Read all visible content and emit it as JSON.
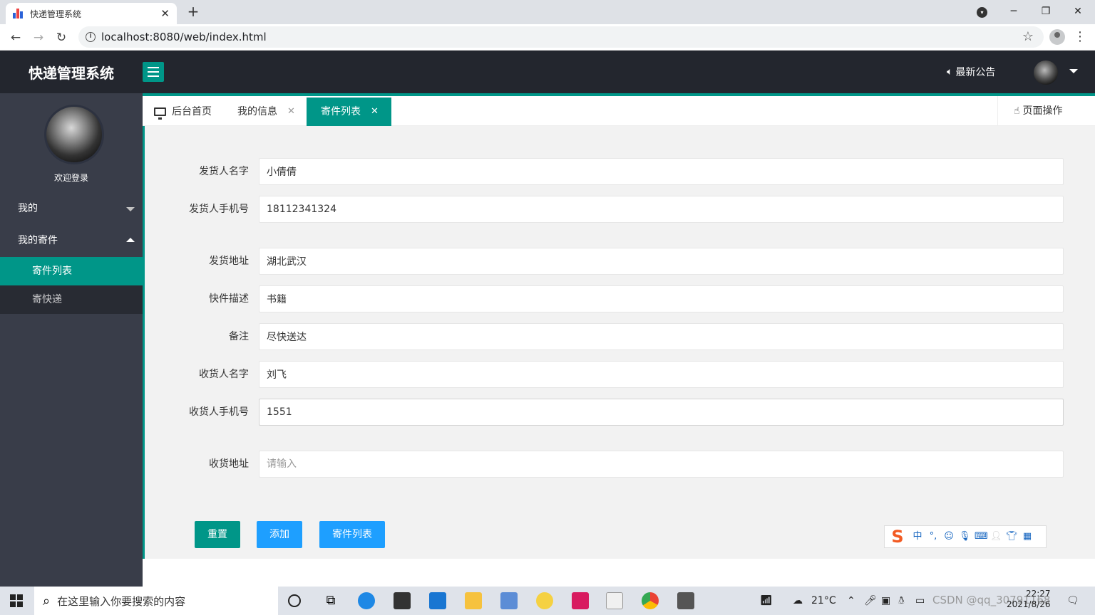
{
  "browser": {
    "tab_title": "快递管理系统",
    "url": "localhost:8080/web/index.html"
  },
  "header": {
    "app_title": "快递管理系统",
    "notice_label": "最新公告"
  },
  "sidebar": {
    "welcome": "欢迎登录",
    "groups": [
      {
        "label": "我的",
        "expanded": false
      },
      {
        "label": "我的寄件",
        "expanded": true
      }
    ],
    "items": [
      {
        "label": "寄件列表",
        "active": true
      },
      {
        "label": "寄快递",
        "active": false
      }
    ]
  },
  "tabs": [
    {
      "label": "后台首页",
      "active": false,
      "closable": false
    },
    {
      "label": "我的信息",
      "active": false,
      "closable": true
    },
    {
      "label": "寄件列表",
      "active": true,
      "closable": true
    }
  ],
  "page_ops_label": "页面操作",
  "form": {
    "fields": [
      {
        "label": "发货人名字",
        "value": "小倩倩",
        "placeholder": ""
      },
      {
        "label": "发货人手机号",
        "value": "18112341324",
        "placeholder": ""
      },
      {
        "label": "发货地址",
        "value": "湖北武汉",
        "placeholder": ""
      },
      {
        "label": "快件描述",
        "value": "书籍",
        "placeholder": ""
      },
      {
        "label": "备注",
        "value": "尽快送达",
        "placeholder": ""
      },
      {
        "label": "收货人名字",
        "value": "刘飞",
        "placeholder": ""
      },
      {
        "label": "收货人手机号",
        "value": "1551",
        "placeholder": ""
      },
      {
        "label": "收货地址",
        "value": "",
        "placeholder": "请输入"
      }
    ],
    "buttons": {
      "reset": "重置",
      "add": "添加",
      "list": "寄件列表"
    }
  },
  "taskbar": {
    "search_placeholder": "在这里输入你要搜索的内容",
    "temperature": "21°C",
    "time": "22:27",
    "date": "2021/8/26",
    "watermark": "CSDN @qq_30791168"
  },
  "colors": {
    "primary": "#009688",
    "blue": "#1e9fff",
    "header_bg": "#23262e",
    "sidebar_bg": "#393d49"
  }
}
